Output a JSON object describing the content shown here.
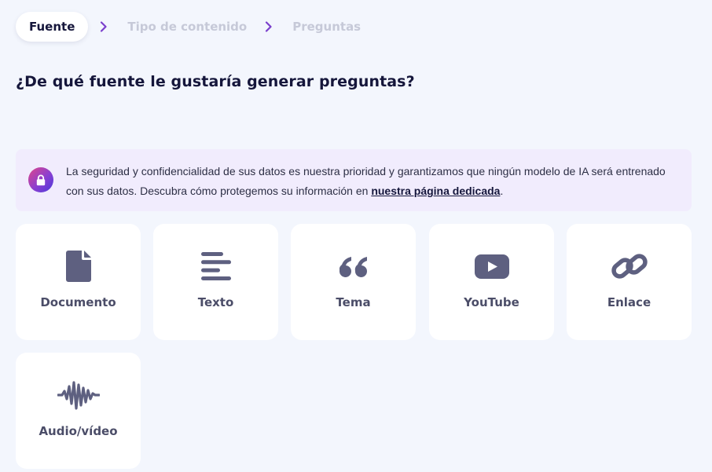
{
  "stepper": {
    "steps": [
      {
        "label": "Fuente",
        "active": true
      },
      {
        "label": "Tipo de contenido",
        "active": false
      },
      {
        "label": "Preguntas",
        "active": false
      }
    ]
  },
  "question": "¿De qué fuente le gustaría generar preguntas?",
  "notice": {
    "text": "La seguridad y confidencialidad de sus datos es nuestra prioridad y garantizamos que ningún modelo de IA será entrenado con sus datos. Descubra cómo protegemos su información en ",
    "link": "nuestra página dedicada",
    "suffix": "."
  },
  "sources": [
    {
      "label": "Documento",
      "icon": "document-icon"
    },
    {
      "label": "Texto",
      "icon": "text-lines-icon"
    },
    {
      "label": "Tema",
      "icon": "quote-icon"
    },
    {
      "label": "YouTube",
      "icon": "youtube-icon"
    },
    {
      "label": "Enlace",
      "icon": "link-icon"
    },
    {
      "label": "Audio/vídeo",
      "icon": "waveform-icon"
    }
  ],
  "colors": {
    "background": "#f3f6fd",
    "card": "#ffffff",
    "icon": "#5e6080",
    "accent": "#8a3fd1",
    "heading": "#15163b",
    "inactive_step": "#c6c9d8",
    "notice_bg": "#f1ecfd"
  }
}
